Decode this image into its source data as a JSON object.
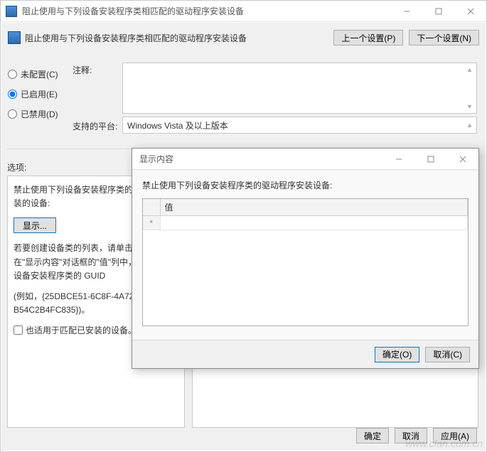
{
  "main": {
    "title": "阻止使用与下列设备安装程序类相匹配的驱动程序安装设备",
    "header_label": "阻止使用与下列设备安装程序类相匹配的驱动程序安装设备",
    "prev_btn": "上一个设置(P)",
    "next_btn": "下一个设置(N)",
    "radios": {
      "unconfigured": "未配置(C)",
      "enabled": "已启用(E)",
      "disabled": "已禁用(D)"
    },
    "comment_label": "注释:",
    "comment_value": "",
    "platform_label": "支持的平台:",
    "platform_value": "Windows Vista 及以上版本",
    "options_label": "选项:",
    "left": {
      "line1": "禁止使用下列设备安装程序类的驱动程序安装的设备:",
      "show_btn": "显示...",
      "line2": "若要创建设备类的列表，请单击\"显示\"。在\"显示内容\"对话框的\"值\"列中，键入表示设备安装程序类的 GUID",
      "line3": "(例如，{25DBCE51-6C8F-4A72-8A6D-B54C2B4FC835})。",
      "chk_label": "也适用于匹配已安装的设备。"
    },
    "footer": {
      "ok": "确定",
      "cancel": "取消",
      "apply": "应用(A)"
    }
  },
  "modal": {
    "title": "显示内容",
    "prompt": "禁止使用下列设备安装程序类的驱动程序安装设备:",
    "col_header": "值",
    "row_marker": "*",
    "cell_value": "",
    "ok_btn": "确定(O)",
    "cancel_btn": "取消(C)"
  },
  "watermark": "www.cfan.com.cn"
}
